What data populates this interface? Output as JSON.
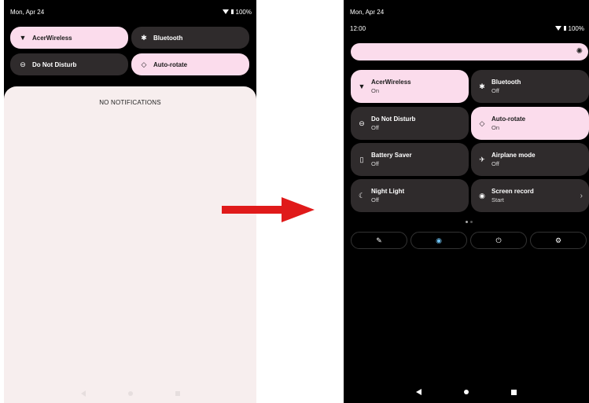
{
  "left": {
    "status": {
      "date": "Mon, Apr 24",
      "battery": "100%"
    },
    "tiles": [
      {
        "label": "AcerWireless",
        "icon": "wifi-icon",
        "state": "on"
      },
      {
        "label": "Bluetooth",
        "icon": "bluetooth-icon",
        "state": "off"
      },
      {
        "label": "Do Not Disturb",
        "icon": "do-not-disturb-icon",
        "state": "off"
      },
      {
        "label": "Auto-rotate",
        "icon": "auto-rotate-icon",
        "state": "on"
      }
    ],
    "notifications_text": "NO NOTIFICATIONS"
  },
  "right": {
    "status": {
      "date": "Mon, Apr 24",
      "time": "12:00",
      "battery": "100%"
    },
    "tiles": [
      {
        "label": "AcerWireless",
        "sub": "On",
        "icon": "wifi-icon",
        "state": "on"
      },
      {
        "label": "Bluetooth",
        "sub": "Off",
        "icon": "bluetooth-icon",
        "state": "off"
      },
      {
        "label": "Do Not Disturb",
        "sub": "Off",
        "icon": "do-not-disturb-icon",
        "state": "off"
      },
      {
        "label": "Auto-rotate",
        "sub": "On",
        "icon": "auto-rotate-icon",
        "state": "on"
      },
      {
        "label": "Battery Saver",
        "sub": "Off",
        "icon": "battery-saver-icon",
        "state": "off"
      },
      {
        "label": "Airplane mode",
        "sub": "Off",
        "icon": "airplane-icon",
        "state": "off"
      },
      {
        "label": "Night Light",
        "sub": "Off",
        "icon": "night-light-icon",
        "state": "off"
      },
      {
        "label": "Screen record",
        "sub": "Start",
        "icon": "screen-record-icon",
        "state": "off"
      }
    ],
    "quick_buttons": [
      "edit-icon",
      "user-icon",
      "power-icon",
      "settings-icon"
    ]
  },
  "colors": {
    "tile_on": "#fbdcec",
    "tile_off": "#2f2b2c",
    "arrow": "#e01a1a"
  }
}
